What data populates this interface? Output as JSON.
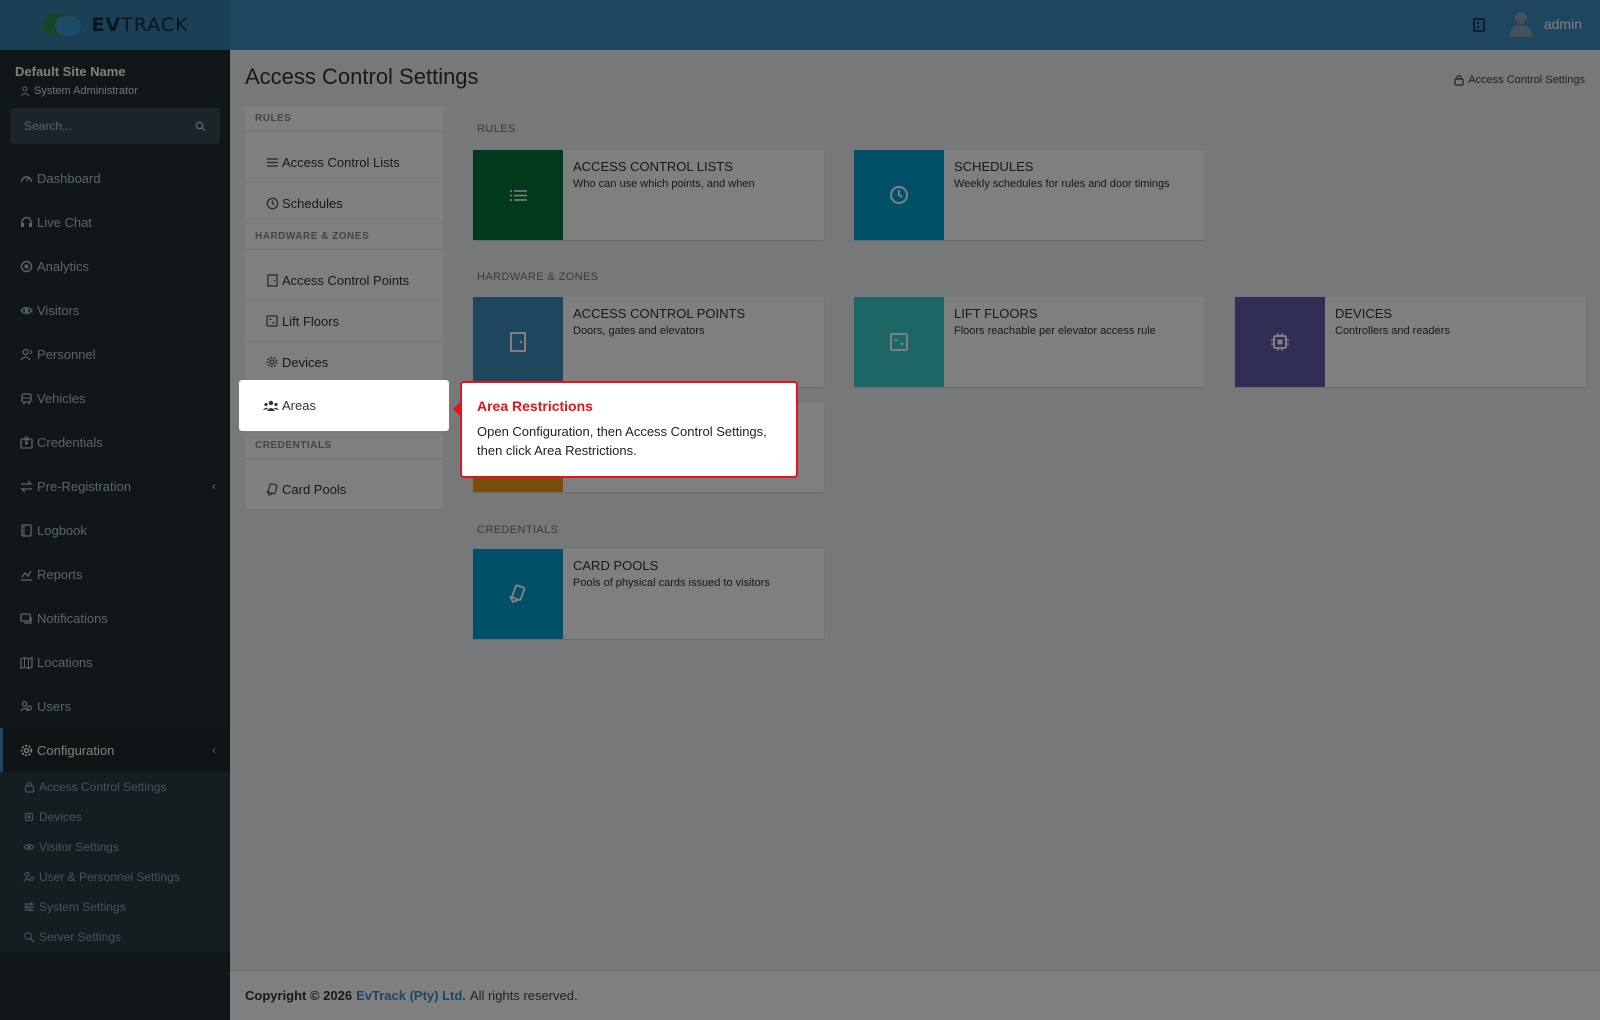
{
  "brand": {
    "logo_text_bold": "EV",
    "logo_text_rest": "TRACK"
  },
  "header": {
    "user_name": "admin"
  },
  "sidebar": {
    "site_name": "Default Site Name",
    "role": "System Administrator",
    "search_placeholder": "Search...",
    "items": [
      {
        "label": "Dashboard",
        "icon": "dashboard-icon"
      },
      {
        "label": "Live Chat",
        "icon": "headset-icon"
      },
      {
        "label": "Analytics",
        "icon": "target-icon"
      },
      {
        "label": "Visitors",
        "icon": "eye-icon"
      },
      {
        "label": "Personnel",
        "icon": "user-tie-icon"
      },
      {
        "label": "Vehicles",
        "icon": "bus-icon"
      },
      {
        "label": "Credentials",
        "icon": "id-card-icon"
      },
      {
        "label": "Pre-Registration",
        "icon": "swap-icon"
      },
      {
        "label": "Logbook",
        "icon": "book-icon"
      },
      {
        "label": "Reports",
        "icon": "chart-icon"
      },
      {
        "label": "Notifications",
        "icon": "chat-icon"
      },
      {
        "label": "Locations",
        "icon": "map-icon"
      },
      {
        "label": "Users",
        "icon": "users-icon"
      },
      {
        "label": "Configuration",
        "icon": "gear-icon"
      }
    ],
    "submenu": [
      {
        "label": "Access Control Settings",
        "icon": "lock-icon"
      },
      {
        "label": "Devices",
        "icon": "chip-icon"
      },
      {
        "label": "Visitor Settings",
        "icon": "eye-icon"
      },
      {
        "label": "User & Personnel Settings",
        "icon": "users-icon"
      },
      {
        "label": "System Settings",
        "icon": "sliders-icon"
      },
      {
        "label": "Server Settings",
        "icon": "server-icon"
      }
    ]
  },
  "page": {
    "title": "Access Control Settings",
    "breadcrumb": "Access Control Settings"
  },
  "left_panel": {
    "rules_head": "RULES",
    "rules": [
      "Access Control Lists",
      "Schedules"
    ],
    "hardware_head": "HARDWARE & ZONES",
    "hardware": [
      "Access Control Points",
      "Lift Floors",
      "Devices",
      "Areas"
    ],
    "credentials_head": "CREDENTIALS",
    "credentials": [
      "Card Pools"
    ]
  },
  "sections": {
    "rules": "RULES",
    "hardware": "HARDWARE & ZONES",
    "credentials": "CREDENTIALS"
  },
  "cards": {
    "acl": {
      "title": "ACCESS CONTROL LISTS",
      "desc": "Who can use which points, and when",
      "color": "#00733c"
    },
    "schedules": {
      "title": "SCHEDULES",
      "desc": "Weekly schedules for rules and door timings",
      "color": "#00a0d2"
    },
    "acp": {
      "title": "ACCESS CONTROL POINTS",
      "desc": "Doors, gates and elevators",
      "color": "#3c8dbc"
    },
    "lift": {
      "title": "LIFT FLOORS",
      "desc": "Floors reachable per elevator access rule",
      "color": "#39cccc"
    },
    "devices": {
      "title": "DEVICES",
      "desc": "Controllers and readers",
      "color": "#605ca8"
    },
    "card_pools": {
      "title": "CARD POOLS",
      "desc": "Pools of physical cards issued to visitors",
      "color": "#00a0d2"
    }
  },
  "tooltip": {
    "title": "Area Restrictions",
    "body": "Open Configuration, then Access Control Settings, then click Area Restrictions."
  },
  "footer": {
    "copyright": "Copyright © 2026",
    "company": "EvTrack (Pty) Ltd.",
    "rights": "All rights reserved."
  }
}
